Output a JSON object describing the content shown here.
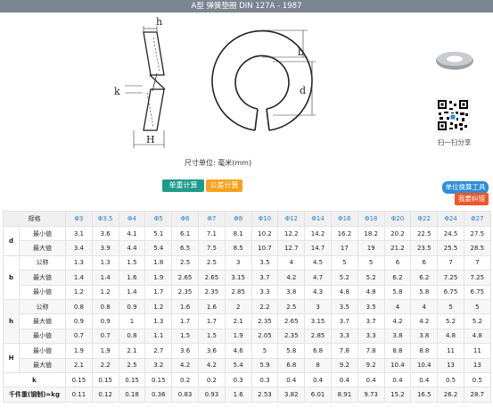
{
  "header": {
    "title": "A型 弹簧垫圈 DIN 127A - 1987"
  },
  "drawing": {
    "dim_h": "h",
    "dim_k": "k",
    "dim_H": "H",
    "dim_b": "b",
    "dim_d": "d",
    "unit_text": "尺寸单位: 毫米(mm)"
  },
  "share": {
    "caption": "扫一扫分享"
  },
  "buttons": {
    "weight_calc": "单重计算",
    "tolerance_calc": "公差计算",
    "unit_convert": "单位换算工具",
    "report_error": "我要纠错"
  },
  "table": {
    "corner": "规格",
    "columns": [
      "Φ3",
      "Φ3.5",
      "Φ4",
      "Φ5",
      "Φ6",
      "Φ7",
      "Φ8",
      "Φ10",
      "Φ12",
      "Φ14",
      "Φ16",
      "Φ18",
      "Φ20",
      "Φ22",
      "Φ24",
      "Φ27"
    ],
    "groups": [
      {
        "name": "d",
        "rows": [
          {
            "label": "最小値",
            "values": [
              "3.1",
              "3.6",
              "4.1",
              "5.1",
              "6.1",
              "7.1",
              "8.1",
              "10.2",
              "12.2",
              "14.2",
              "16.2",
              "18.2",
              "20.2",
              "22.5",
              "24.5",
              "27.5"
            ]
          },
          {
            "label": "最大値",
            "values": [
              "3.4",
              "3.9",
              "4.4",
              "5.4",
              "6.5",
              "7.5",
              "8.5",
              "10.7",
              "12.7",
              "14.7",
              "17",
              "19",
              "21.2",
              "23.5",
              "25.5",
              "28.5"
            ]
          }
        ]
      },
      {
        "name": "b",
        "rows": [
          {
            "label": "公称",
            "values": [
              "1.3",
              "1.3",
              "1.5",
              "1.8",
              "2.5",
              "2.5",
              "3",
              "3.5",
              "4",
              "4.5",
              "5",
              "5",
              "6",
              "6",
              "7",
              "7"
            ]
          },
          {
            "label": "最大値",
            "values": [
              "1.4",
              "1.4",
              "1.6",
              "1.9",
              "2.65",
              "2.65",
              "3.15",
              "3.7",
              "4.2",
              "4.7",
              "5.2",
              "5.2",
              "6.2",
              "6.2",
              "7.25",
              "7.25"
            ]
          },
          {
            "label": "最小値",
            "values": [
              "1.2",
              "1.2",
              "1.4",
              "1.7",
              "2.35",
              "2.35",
              "2.85",
              "3.3",
              "3.8",
              "4.3",
              "4.8",
              "4.8",
              "5.8",
              "5.8",
              "6.75",
              "6.75"
            ]
          }
        ]
      },
      {
        "name": "h",
        "rows": [
          {
            "label": "公称",
            "values": [
              "0.8",
              "0.8",
              "0.9",
              "1.2",
              "1.6",
              "1.6",
              "2",
              "2.2",
              "2.5",
              "3",
              "3.5",
              "3.5",
              "4",
              "4",
              "5",
              "5"
            ]
          },
          {
            "label": "最大値",
            "values": [
              "0.9",
              "0.9",
              "1",
              "1.3",
              "1.7",
              "1.7",
              "2.1",
              "2.35",
              "2.65",
              "3.15",
              "3.7",
              "3.7",
              "4.2",
              "4.2",
              "5.2",
              "5.2"
            ]
          },
          {
            "label": "最小値",
            "values": [
              "0.7",
              "0.7",
              "0.8",
              "1.1",
              "1.5",
              "1.5",
              "1.9",
              "2.05",
              "2.35",
              "2.85",
              "3.3",
              "3.3",
              "3.8",
              "3.8",
              "4.8",
              "4.8"
            ]
          }
        ]
      },
      {
        "name": "H",
        "rows": [
          {
            "label": "最小値",
            "values": [
              "1.9",
              "1.9",
              "2.1",
              "2.7",
              "3.6",
              "3.6",
              "4.6",
              "5",
              "5.8",
              "6.8",
              "7.8",
              "7.8",
              "8.8",
              "8.8",
              "11",
              "11"
            ]
          },
          {
            "label": "最大値",
            "values": [
              "2.1",
              "2.2",
              "2.5",
              "3.2",
              "4.2",
              "4.2",
              "5.4",
              "5.9",
              "6.8",
              "8",
              "9.2",
              "9.2",
              "10.4",
              "10.4",
              "13",
              "13"
            ]
          }
        ]
      }
    ],
    "k_row": {
      "label": "k",
      "values": [
        "0.15",
        "0.15",
        "0.15",
        "0.15",
        "0.2",
        "0.2",
        "0.3",
        "0.3",
        "0.4",
        "0.4",
        "0.4",
        "0.4",
        "0.4",
        "0.4",
        "0.5",
        "0.5"
      ]
    },
    "weight_row": {
      "label": "千件重(钢制)≈kg",
      "values": [
        "0.11",
        "0.12",
        "0.18",
        "0.36",
        "0.83",
        "0.93",
        "1.6",
        "2.53",
        "3.82",
        "6.01",
        "8.91",
        "9.73",
        "15.2",
        "16.5",
        "26.2",
        "28.7"
      ]
    }
  }
}
